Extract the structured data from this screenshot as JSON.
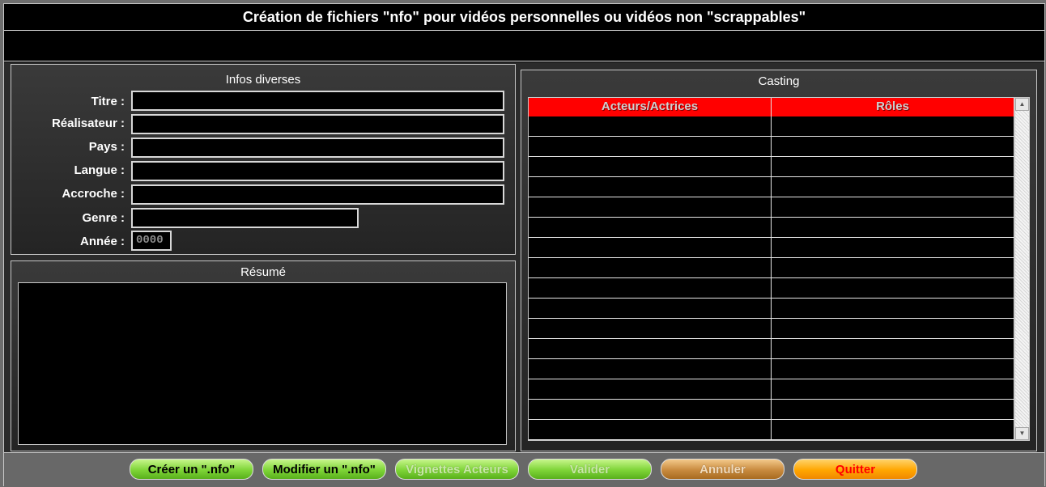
{
  "window": {
    "title": "Création de fichiers \"nfo\" pour vidéos personnelles ou vidéos non \"scrappables\""
  },
  "infos": {
    "title": "Infos diverses",
    "fields": [
      {
        "label": "Titre :",
        "value": ""
      },
      {
        "label": "Réalisateur :",
        "value": ""
      },
      {
        "label": "Pays :",
        "value": ""
      },
      {
        "label": "Langue :",
        "value": ""
      },
      {
        "label": "Accroche :",
        "value": ""
      },
      {
        "label": "Genre :",
        "value": ""
      },
      {
        "label": "Année :",
        "value": "0000"
      }
    ]
  },
  "resume": {
    "title": "Résumé",
    "value": ""
  },
  "casting": {
    "title": "Casting",
    "columns": [
      "Acteurs/Actrices",
      "Rôles"
    ],
    "rows": [
      [
        "",
        ""
      ],
      [
        "",
        ""
      ],
      [
        "",
        ""
      ],
      [
        "",
        ""
      ],
      [
        "",
        ""
      ],
      [
        "",
        ""
      ],
      [
        "",
        ""
      ],
      [
        "",
        ""
      ],
      [
        "",
        ""
      ],
      [
        "",
        ""
      ],
      [
        "",
        ""
      ],
      [
        "",
        ""
      ],
      [
        "",
        ""
      ],
      [
        "",
        ""
      ],
      [
        "",
        ""
      ],
      [
        "",
        ""
      ]
    ]
  },
  "buttons": {
    "creer": "Créer un \".nfo\"",
    "modifier": "Modifier un \".nfo\"",
    "vignettes": "Vignettes Acteurs",
    "valider": "Valider",
    "annuler": "Annuler",
    "quitter": "Quitter"
  },
  "colors": {
    "grid_header": "#ff0000",
    "quit_text": "#ff0000",
    "background": "#000000"
  }
}
